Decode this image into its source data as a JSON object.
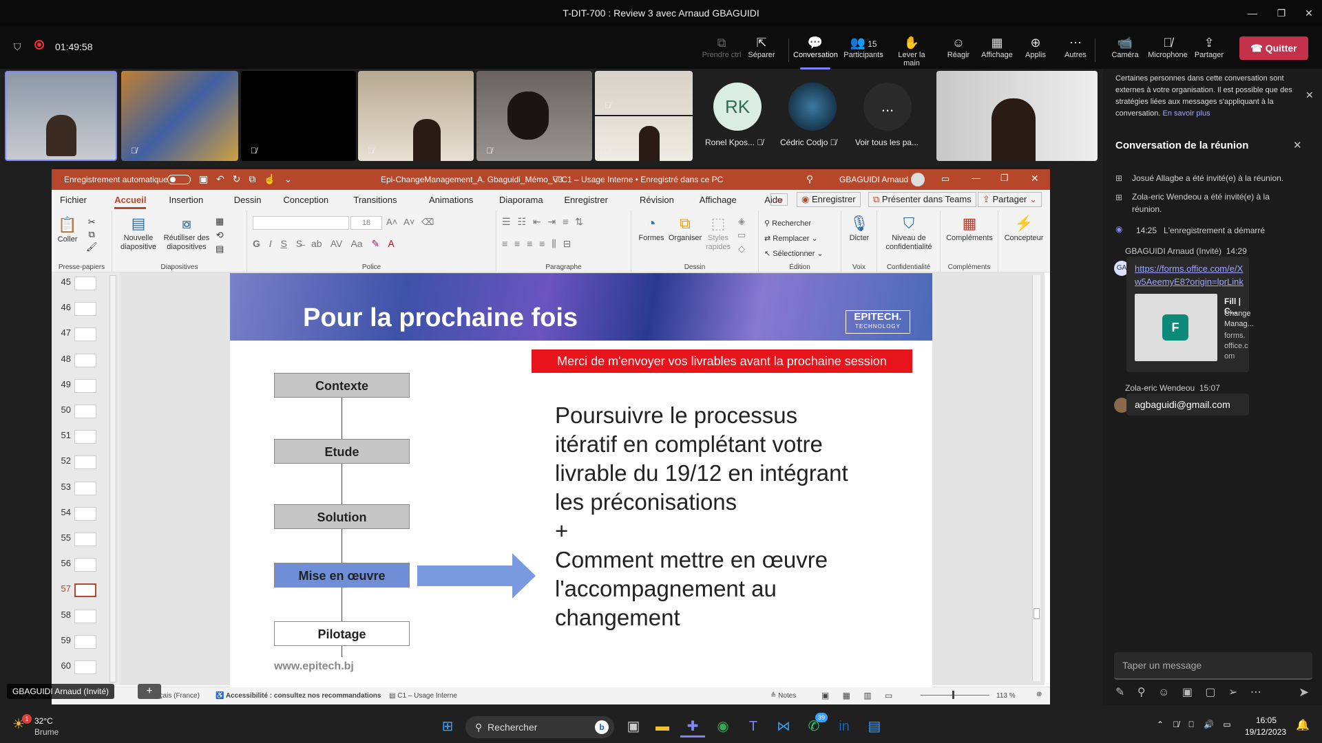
{
  "window": {
    "title": "T-DIT-700 : Review 3 avec Arnaud GBAGUIDI"
  },
  "meeting": {
    "timer": "01:49:58",
    "toolbar": [
      {
        "label": "Prendre ctrl",
        "icon": "control-icon",
        "disabled": true
      },
      {
        "label": "Séparer",
        "icon": "popout-icon"
      },
      {
        "label": "Conversation",
        "icon": "chat-icon",
        "active": true
      },
      {
        "label": "Participants",
        "icon": "people-icon",
        "count": "15"
      },
      {
        "label": "Lever la main",
        "icon": "hand-icon"
      },
      {
        "label": "Réagir",
        "icon": "smiley-icon"
      },
      {
        "label": "Affichage",
        "icon": "grid-icon"
      },
      {
        "label": "Applis",
        "icon": "plus-icon"
      },
      {
        "label": "Autres",
        "icon": "more-icon"
      },
      {
        "label": "Caméra",
        "icon": "camera-icon"
      },
      {
        "label": "Microphone",
        "icon": "mic-off-icon"
      },
      {
        "label": "Partager",
        "icon": "share-icon"
      }
    ],
    "leave_label": "Quitter",
    "participants": [
      {
        "initials": "RK",
        "name": "Ronel Kpos..."
      },
      {
        "initials": "",
        "name": "Cédric Codjo"
      },
      {
        "initials": "...",
        "name": "Voir tous les pa..."
      }
    ],
    "presenter_label": "GBAGUIDI Arnaud (Invité)"
  },
  "chat": {
    "banner": "Certaines personnes dans cette conversation sont externes à votre organisation. Il est possible que des stratégies liées aux messages s'appliquant à la conversation.",
    "banner_link": "En savoir plus",
    "title": "Conversation de la réunion",
    "events": [
      "Josué Allagbe a été invité(e) à la réunion.",
      "Zola-eric Wendeou a été invité(e) à la réunion.",
      "14:25   L'enregistrement a démarré"
    ],
    "messages": [
      {
        "author": "GBAGUIDI Arnaud (Invité)",
        "time": "14:29",
        "avatar": "GA",
        "link": "https://forms.office.com/e/Xw5AeemyE8?origin=lprLink",
        "card_title": "Fill | C...",
        "card_sub": "Change Manag...",
        "card_domain": "forms.office.com"
      },
      {
        "author": "Zola-eric Wendeou",
        "time": "15:07",
        "text": "agbaguidi@gmail.com"
      }
    ],
    "input_placeholder": "Taper un message"
  },
  "ppt": {
    "autosave": "Enregistrement automatique",
    "filename": "Epi-ChangeManagement_A. Gbaguidi_Mémo_V3",
    "sensitivity": "C1 – Usage Interne • Enregistré dans ce PC",
    "user": "GBAGUIDI Arnaud",
    "menus": [
      "Fichier",
      "Accueil",
      "Insertion",
      "Dessin",
      "Conception",
      "Transitions",
      "Animations",
      "Diaporama",
      "Enregistrer",
      "Révision",
      "Affichage",
      "Aide"
    ],
    "active_menu": "Accueil",
    "ribbon_actions": {
      "record": "Enregistrer",
      "present": "Présenter dans Teams",
      "share": "Partager"
    },
    "groups": {
      "clipboard": "Presse-papiers",
      "slides": "Diapositives",
      "font": "Police",
      "paragraph": "Paragraphe",
      "drawing": "Dessin",
      "editing": "Édition",
      "voice": "Voix",
      "confidentiality": "Confidentialité",
      "addins": "Compléments"
    },
    "buttons": {
      "paste": "Coller",
      "new_slide": "Nouvelle diapositive",
      "reuse": "Réutiliser des diapositives",
      "font_size": "18",
      "shapes": "Formes",
      "arrange": "Organiser",
      "quick_styles": "Styles rapides",
      "find": "Rechercher",
      "replace": "Remplacer",
      "select": "Sélectionner",
      "dictate": "Dicter",
      "sensitivity_level": "Niveau de confidentialité",
      "addins": "Compléments",
      "designer": "Concepteur"
    },
    "thumbnails": [
      "45",
      "46",
      "47",
      "48",
      "49",
      "50",
      "51",
      "52",
      "53",
      "54",
      "55",
      "56",
      "57",
      "58",
      "59",
      "60"
    ],
    "current_slide": "57",
    "status": {
      "lang": "Français (France)",
      "accessibility": "Accessibilité : consultez nos recommandations",
      "label": "C1 – Usage Interne",
      "notes": "Notes",
      "zoom": "113 %"
    }
  },
  "slide": {
    "title": "Pour la prochaine fois",
    "logo": "EPITECH.",
    "logo_sub": "TECHNOLOGY",
    "banner": "Merci de m'envoyer vos livrables avant la prochaine session",
    "steps": [
      "Contexte",
      "Etude",
      "Solution",
      "Mise en œuvre",
      "Pilotage"
    ],
    "highlighted_step": "Mise en œuvre",
    "body": [
      "Poursuivre le processus",
      "itératif en complétant votre",
      "livrable du 19/12 en intégrant",
      "les préconisations",
      "+",
      "Comment mettre en œuvre",
      "l'accompagnement au",
      "changement"
    ],
    "footer": "www.epitech.bj"
  },
  "taskbar": {
    "weather_temp": "32°C",
    "weather_desc": "Brume",
    "search": "Rechercher",
    "time": "16:05",
    "date": "19/12/2023",
    "whatsapp_badge": "39"
  },
  "colors": {
    "accent": "#7f85f5",
    "leave": "#c4314b",
    "ppt": "#b7472a",
    "banner": "#e8141c",
    "step_hl": "#6e8fd8"
  }
}
